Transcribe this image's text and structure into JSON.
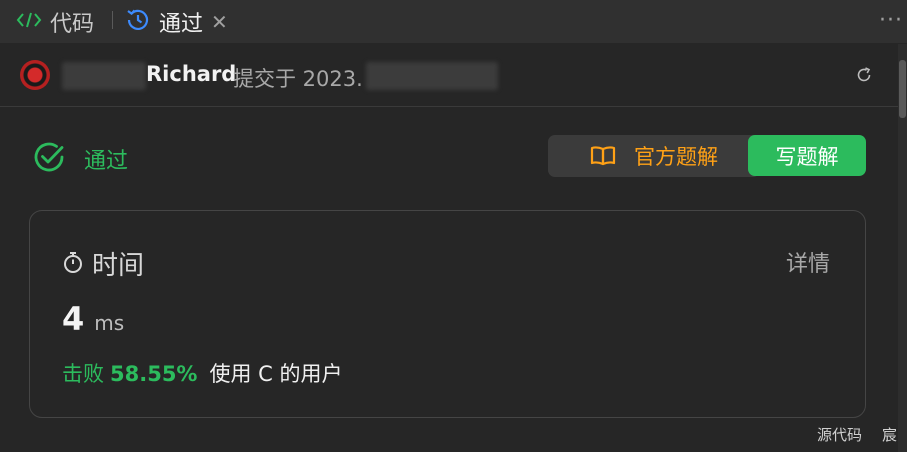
{
  "tabs": {
    "code_label": "代码",
    "pass_label": "通过",
    "close_glyph": "✕",
    "more_glyph": "···"
  },
  "submission": {
    "user": "Richard",
    "submitted_text": "提交于 2023."
  },
  "result": {
    "status": "通过",
    "official_solution_label": "官方题解",
    "write_solution_label": "写题解"
  },
  "runtime_card": {
    "title": "时间",
    "details_label": "详情",
    "value": "4",
    "unit": "ms",
    "beats_prefix": "击败",
    "beats_percent": "58.55%",
    "beats_suffix": "使用 C 的用户"
  },
  "footer": {
    "source_label": "源代码",
    "truncated_label": "宸"
  },
  "colors": {
    "accent_green": "#2cbb5d",
    "accent_orange": "#ffa116",
    "accent_blue": "#3d8bfd",
    "background": "#262626"
  }
}
